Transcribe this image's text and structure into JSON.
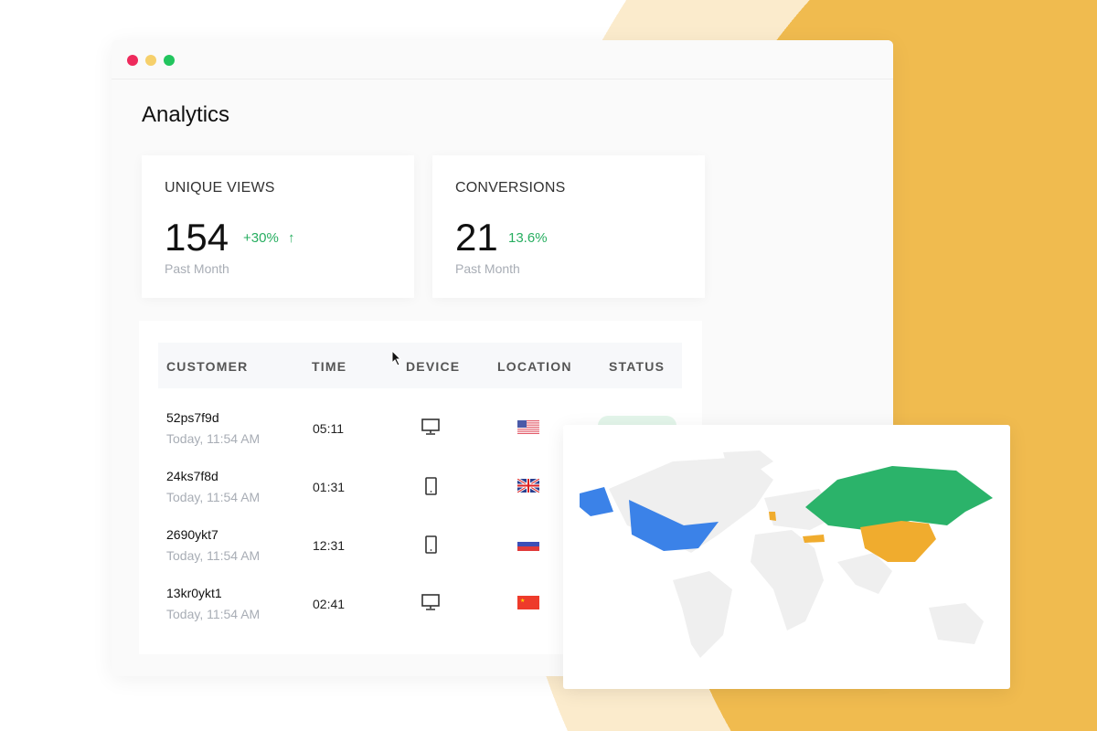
{
  "window": {
    "title": "Analytics"
  },
  "cards": [
    {
      "title": "UNIQUE VIEWS",
      "value": "154",
      "delta": "+30%",
      "delta_icon": "arrow-up-icon",
      "subtitle": "Past Month"
    },
    {
      "title": "CONVERSIONS",
      "value": "21",
      "delta": "13.6%",
      "subtitle": "Past Month"
    }
  ],
  "table": {
    "headers": [
      "CUSTOMER",
      "TIME",
      "DEVICE",
      "LOCATION",
      "STATUS"
    ],
    "rows": [
      {
        "customer": "52ps7f9d",
        "timestamp": "Today, 11:54 AM",
        "time": "05:11",
        "device": "desktop-icon",
        "location": "us-flag-icon"
      },
      {
        "customer": "24ks7f8d",
        "timestamp": "Today, 11:54 AM",
        "time": "01:31",
        "device": "mobile-icon",
        "location": "uk-flag-icon"
      },
      {
        "customer": "2690ykt7",
        "timestamp": "Today, 11:54 AM",
        "time": "12:31",
        "device": "mobile-icon",
        "location": "russia-flag-icon"
      },
      {
        "customer": "13kr0ykt1",
        "timestamp": "Today, 11:54 AM",
        "time": "02:41",
        "device": "desktop-icon",
        "location": "china-flag-icon"
      }
    ]
  },
  "map": {
    "colors": {
      "base": "#efefef",
      "blue": "#3b82e8",
      "green": "#2bb36a",
      "orange": "#f0ac2e"
    },
    "highlighted": {
      "blue": [
        "USA"
      ],
      "green": [
        "Russia"
      ],
      "orange": [
        "China",
        "UK",
        "Turkey"
      ]
    }
  },
  "colors": {
    "accent_green": "#27ae60",
    "bg_yellow": "#f0bb4f"
  }
}
